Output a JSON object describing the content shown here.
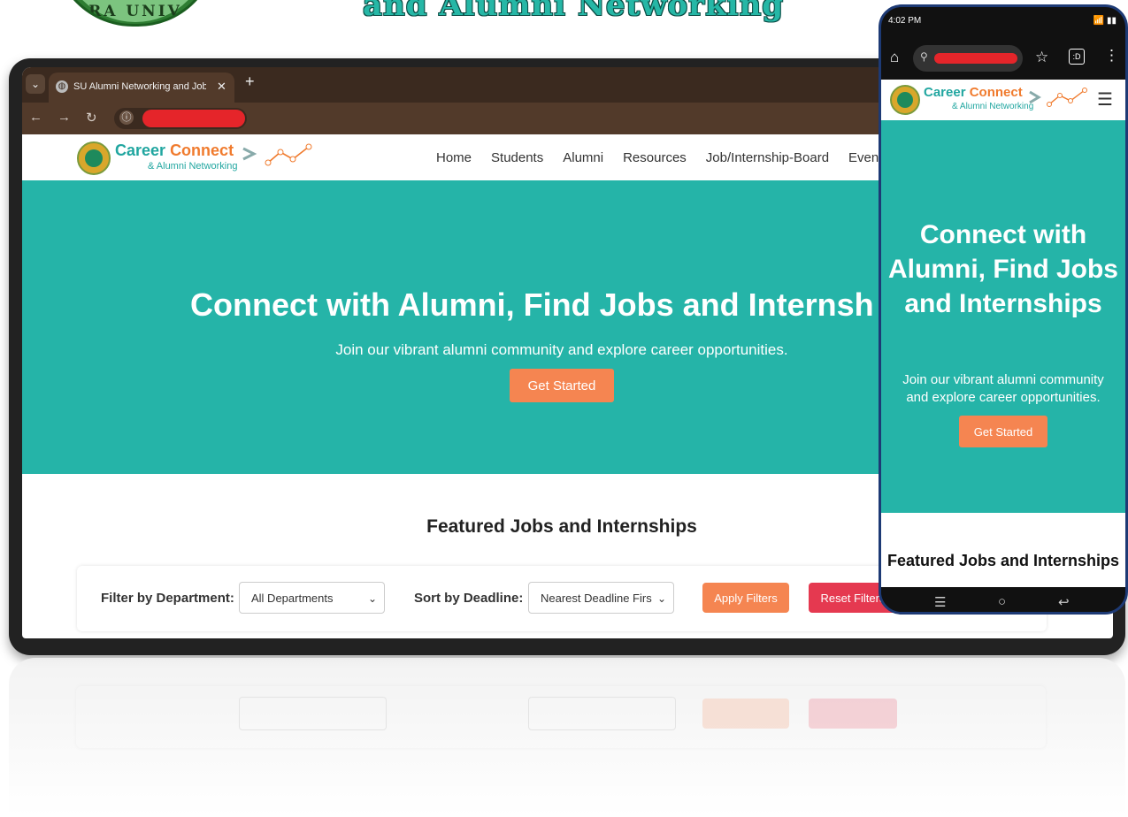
{
  "banner": {
    "title": "and Alumni Networking",
    "seal_text": "RA UNIV"
  },
  "browser": {
    "tab_title": "SU Alumni Networking and Job",
    "tab_dropdown": "⌄",
    "tab_close": "✕",
    "new_tab": "+"
  },
  "site": {
    "brand_part1": "Career",
    "brand_part2": "Connect",
    "brand_sub": "& Alumni Networking",
    "nav": [
      "Home",
      "Students",
      "Alumni",
      "Resources",
      "Job/Internship-Board",
      "Events"
    ]
  },
  "hero": {
    "title": "Connect with Alumni, Find Jobs and Internsh",
    "subtitle": "Join our vibrant alumni community and explore career opportunities.",
    "cta": "Get Started"
  },
  "featured": {
    "title": "Featured Jobs and Internships",
    "filter_label": "Filter by Department:",
    "filter_value": "All Departments",
    "sort_label": "Sort by Deadline:",
    "sort_value": "Nearest Deadline Firs",
    "apply": "Apply Filters",
    "reset": "Reset Filters"
  },
  "phone": {
    "time": "4:02 PM",
    "hero_title": "Connect with Alumni, Find Jobs and Internships",
    "hero_subtitle": "Join our vibrant alumni community and explore career opportunities.",
    "cta": "Get Started",
    "featured": "Featured Jobs and Internships"
  },
  "colors": {
    "teal": "#25b4a8",
    "orange": "#f58551",
    "red": "#e53950",
    "brand_teal": "#21a6a0",
    "brand_orange": "#f07b2e"
  }
}
